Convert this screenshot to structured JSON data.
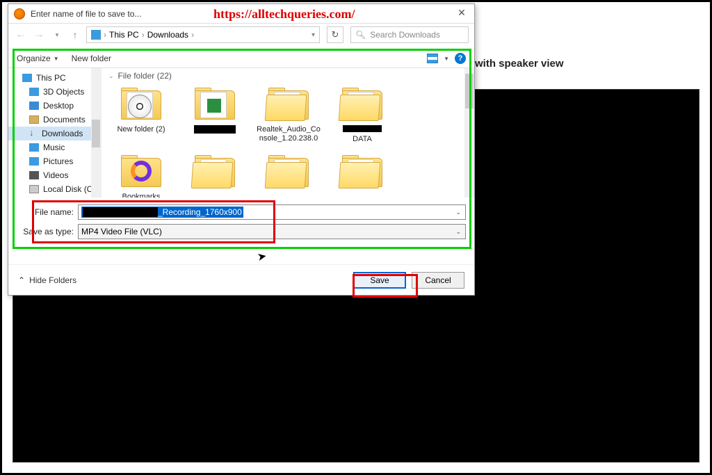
{
  "watermark_url": "https://alltechqueries.com/",
  "dialog": {
    "title": "Enter name of file to save to...",
    "breadcrumb": {
      "root": "This PC",
      "current": "Downloads"
    },
    "search_placeholder": "Search Downloads",
    "toolbar": {
      "organize": "Organize",
      "new_folder": "New folder"
    },
    "sidebar": [
      {
        "label": "This PC",
        "icon": "pc"
      },
      {
        "label": "3D Objects",
        "icon": "3d"
      },
      {
        "label": "Desktop",
        "icon": "desk"
      },
      {
        "label": "Documents",
        "icon": "doc"
      },
      {
        "label": "Downloads",
        "icon": "dl",
        "selected": true
      },
      {
        "label": "Music",
        "icon": "music"
      },
      {
        "label": "Pictures",
        "icon": "pic"
      },
      {
        "label": "Videos",
        "icon": "vid"
      },
      {
        "label": "Local Disk (C:)",
        "icon": "disk"
      }
    ],
    "group_header": "File folder (22)",
    "folders": [
      {
        "label": "New folder (2)",
        "variant": "disc"
      },
      {
        "label": "██████████",
        "variant": "green",
        "redacted": true
      },
      {
        "label": "Realtek_Audio_Console_1.20.238.0",
        "variant": "plain"
      },
      {
        "label": "██████████ DATA",
        "variant": "plain",
        "redacted_prefix": true
      },
      {
        "label": "Bookmarks Backup",
        "variant": "bookmark"
      }
    ],
    "filename_label": "File name:",
    "filename_value_suffix": "_Recording_1760x900",
    "savetype_label": "Save as type:",
    "savetype_value": "MP4 Video File (VLC)",
    "hide_folders": "Hide Folders",
    "save_btn": "Save",
    "cancel_btn": "Cancel"
  },
  "background_text": "with speaker view"
}
